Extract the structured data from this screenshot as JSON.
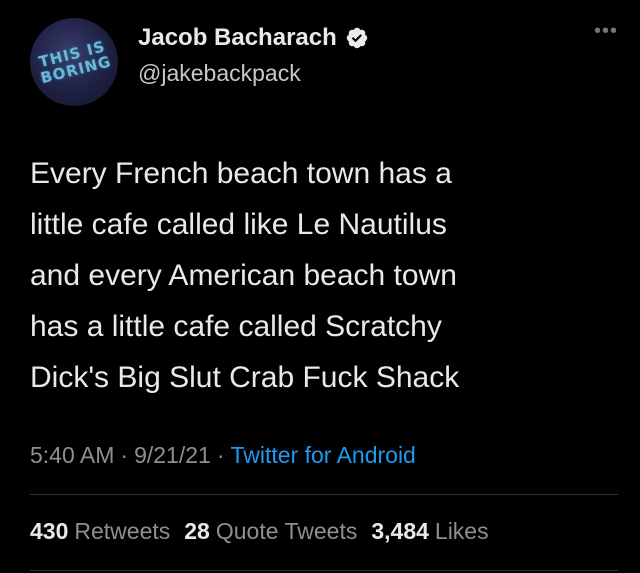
{
  "user": {
    "display_name": "Jacob Bacharach",
    "handle": "@jakebackpack",
    "avatar_text": "THIS IS BORING",
    "verified_icon": "verified-badge-icon"
  },
  "menu": {
    "more_label": "•••"
  },
  "tweet": {
    "text": "Every French beach town has a\nlittle cafe called like Le Nautilus\nand every American beach town\nhas a little cafe called Scratchy\nDick's Big Slut Crab Fuck Shack"
  },
  "meta": {
    "time": "5:40 AM",
    "separator": "·",
    "date": "9/21/21",
    "source": "Twitter for Android"
  },
  "stats": {
    "retweets_count": "430",
    "retweets_label": "Retweets",
    "quotes_count": "28",
    "quotes_label": "Quote Tweets",
    "likes_count": "3,484",
    "likes_label": "Likes"
  },
  "colors": {
    "background": "#000000",
    "text": "#e7e9ea",
    "secondary": "#8b9095",
    "link": "#1d9bf0"
  }
}
